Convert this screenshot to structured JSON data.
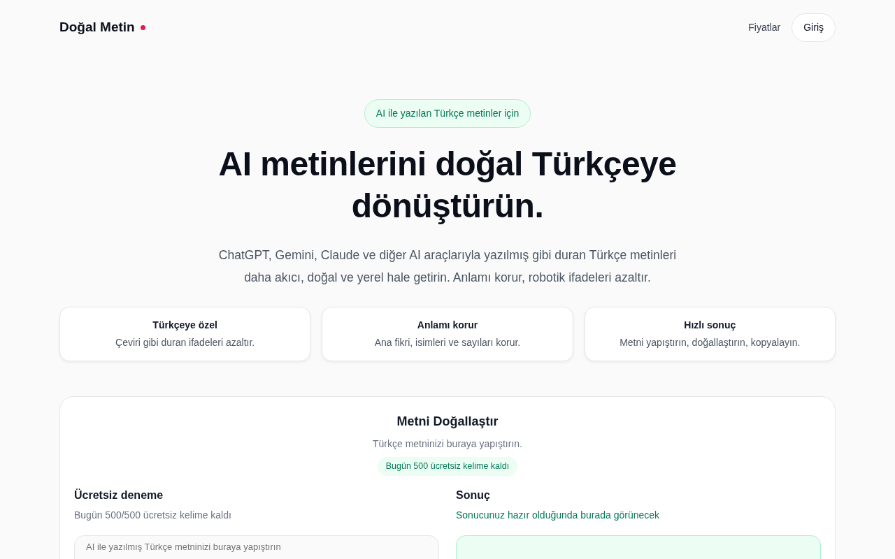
{
  "brand": {
    "name": "Doğal Metin"
  },
  "nav": {
    "links": [
      "Fiyatlar"
    ],
    "login": "Giriş"
  },
  "hero": {
    "badge": "AI ile yazılan Türkçe metinler için",
    "title": "AI metinlerini doğal Türkçeye dönüştürün.",
    "subtitle": "ChatGPT, Gemini, Claude ve diğer AI araçlarıyla yazılmış gibi duran Türkçe metinleri daha akıcı, doğal ve yerel hale getirin. Anlamı korur, robotik ifadeleri azaltır."
  },
  "features": [
    {
      "title": "Türkçeye özel",
      "text": "Çeviri gibi duran ifadeleri azaltır."
    },
    {
      "title": "Anlamı korur",
      "text": "Ana fikri, isimleri ve sayıları korur."
    },
    {
      "title": "Hızlı sonuç",
      "text": "Metni yapıştırın, doğallaştırın, kopyalayın."
    }
  ],
  "tool": {
    "title": "Metni Doğallaştır",
    "subtitle": "Türkçe metninizi buraya yapıştırın.",
    "quota_badge": "Bugün 500 ücretsiz kelime kaldı",
    "input": {
      "heading": "Ücretsiz deneme",
      "note": "Bugün 500/500 ücretsiz kelime kaldı",
      "placeholder": "AI ile yazılmış Türkçe metninizi buraya yapıştırın"
    },
    "output": {
      "heading": "Sonuç",
      "note": "Sonucunuz hazır olduğunda burada görünecek"
    }
  }
}
